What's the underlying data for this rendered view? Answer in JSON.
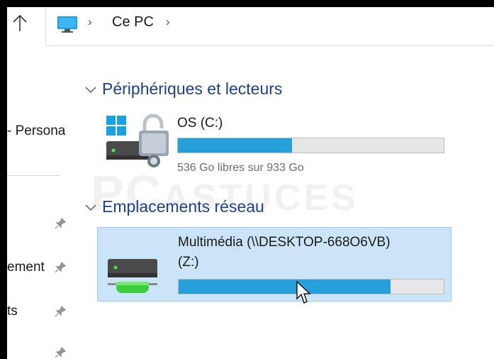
{
  "address": {
    "location": "Ce PC",
    "separator": "›"
  },
  "nav": {
    "item_persona": "- Persona",
    "item_ement": "ement",
    "item_ts": "ts"
  },
  "groups": [
    {
      "title": "Périphériques et lecteurs"
    },
    {
      "title": "Emplacements réseau"
    }
  ],
  "drives": [
    {
      "label": "OS (C:)",
      "free_text": "536 Go libres sur 933 Go",
      "used_fraction": 0.43
    },
    {
      "label_line1": "Multimédia (\\\\DESKTOP-668O6VB)",
      "label_line2": "(Z:)",
      "used_fraction": 0.8
    }
  ],
  "colors": {
    "bar_fill": "#26a0da",
    "selection_bg": "#cce4f7",
    "group_header": "#1f3f8f"
  }
}
